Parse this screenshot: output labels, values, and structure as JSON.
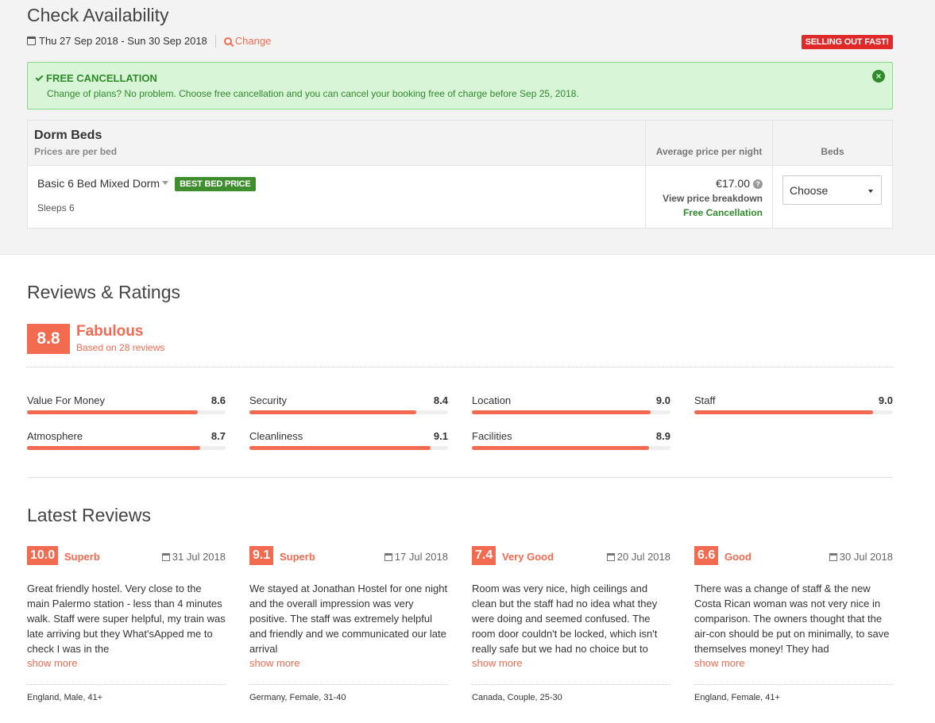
{
  "availability": {
    "title": "Check Availability",
    "dates": "Thu 27 Sep 2018 - Sun 30 Sep 2018",
    "change_label": "Change",
    "selling_badge": "SELLING OUT FAST!"
  },
  "cancellation": {
    "title": "FREE CANCELLATION",
    "description": "Change of plans? No problem. Choose free cancellation and you can cancel your booking free of charge before Sep 25, 2018."
  },
  "rooms": {
    "header": {
      "name": "Dorm Beds",
      "sub": "Prices are per bed",
      "avg_price": "Average price per night",
      "beds": "Beds"
    },
    "rows": [
      {
        "name": "Basic 6 Bed Mixed Dorm",
        "badge": "BEST BED PRICE",
        "sleeps": "Sleeps 6",
        "price": "€17.00",
        "breakdown": "View price breakdown",
        "free": "Free Cancellation",
        "select_value": "Choose"
      }
    ]
  },
  "reviews": {
    "title": "Reviews & Ratings",
    "score": "8.8",
    "score_word": "Fabulous",
    "based_on": "Based on 28 reviews",
    "ratings": [
      {
        "label": "Value For Money",
        "value": "8.6",
        "fraction": 0.86
      },
      {
        "label": "Security",
        "value": "8.4",
        "fraction": 0.84
      },
      {
        "label": "Location",
        "value": "9.0",
        "fraction": 0.9
      },
      {
        "label": "Staff",
        "value": "9.0",
        "fraction": 0.9
      },
      {
        "label": "Atmosphere",
        "value": "8.7",
        "fraction": 0.87
      },
      {
        "label": "Cleanliness",
        "value": "9.1",
        "fraction": 0.91
      },
      {
        "label": "Facilities",
        "value": "8.9",
        "fraction": 0.89
      }
    ]
  },
  "latest": {
    "title": "Latest Reviews",
    "show_more": "show more",
    "items": [
      {
        "score": "10.0",
        "word": "Superb",
        "date": "31 Jul 2018",
        "text": "Great friendly hostel. Very close to the main Palermo station - less than 4 minutes walk. Staff were super helpful, my train was late arriving but they What'sApped me to check I was in the",
        "author": "England, Male, 41+"
      },
      {
        "score": "9.1",
        "word": "Superb",
        "date": "17 Jul 2018",
        "text": "We stayed at Jonathan Hostel for one night and the overall impression was very positive. The staff was extremely helpful and friendly and we communicated our late arrival",
        "author": "Germany, Female, 31-40"
      },
      {
        "score": "7.4",
        "word": "Very Good",
        "date": "20 Jul 2018",
        "text": "Room was very nice, high ceilings and clean but the staff had no idea what they were doing and seemed confused. The room door couldn't be locked, which isn't really safe but we had no choice but to",
        "author": "Canada, Couple, 25-30"
      },
      {
        "score": "6.6",
        "word": "Good",
        "date": "30 Jul 2018",
        "text": "There was a change of staff & the new Costa Rican woman was not very nice in comparison. The owners thought that the air-con should be put on minimally, to save themselves money! They had",
        "author": "England, Female, 41+"
      }
    ]
  }
}
